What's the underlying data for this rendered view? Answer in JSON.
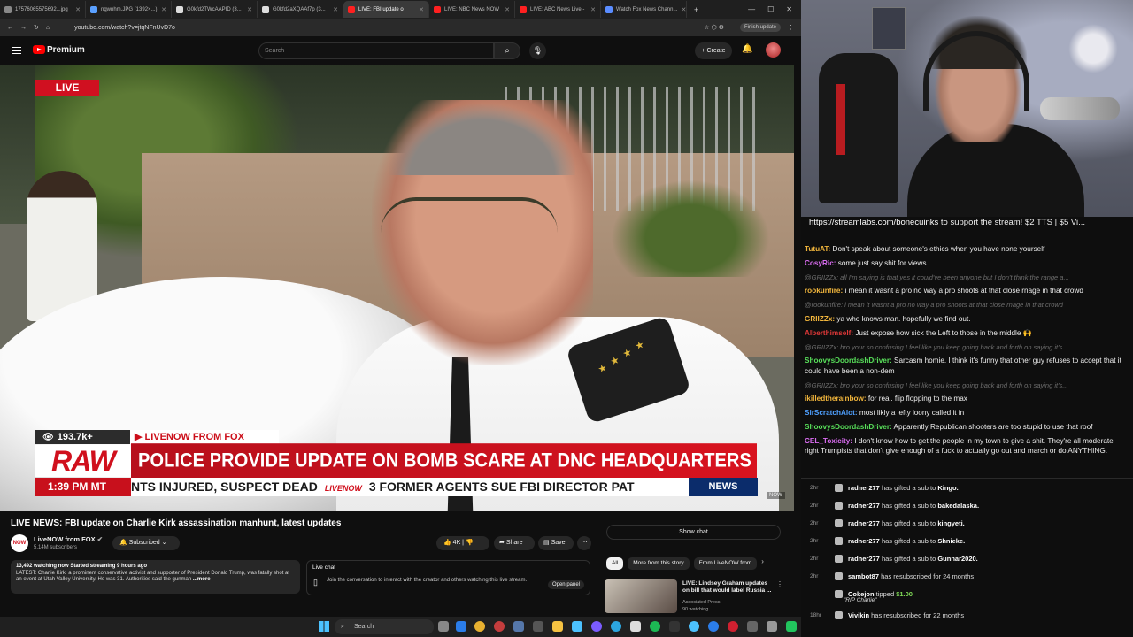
{
  "browser": {
    "tabs": [
      {
        "label": "17576065575692...jpg",
        "color": "#888888",
        "active": false
      },
      {
        "label": "ngwnhm.JPG (1392×...)",
        "color": "#5aa0ff",
        "active": false
      },
      {
        "label": "G0kfd2TWcAAPID (3...",
        "color": "#dddddd",
        "active": false
      },
      {
        "label": "G0kfd2aXQAAf7p (3...",
        "color": "#dddddd",
        "active": false
      },
      {
        "label": "LIVE: FBI update o",
        "color": "#ff2020",
        "active": true
      },
      {
        "label": "LIVE: NBC News NOW",
        "color": "#ff2020",
        "active": false
      },
      {
        "label": "LIVE: ABC News Live -",
        "color": "#ff2020",
        "active": false
      },
      {
        "label": "Watch Fox News Chann...",
        "color": "#5a8cff",
        "active": false
      }
    ],
    "url": "youtube.com/watch?v=jtqNFnUvD7o",
    "update_label": "Finish update"
  },
  "youtube": {
    "brand": "Premium",
    "search_placeholder": "Search",
    "create_label": "Create",
    "live_tag": "LIVE",
    "lower_third": {
      "viewers": "193.7k+",
      "source": "LIVENOW FROM FOX",
      "raw": "RAW",
      "headline": "POLICE PROVIDE UPDATE ON BOMB SCARE AT DNC HEADQUARTERS",
      "time": "1:39 PM MT",
      "ticker_a": "NTS INJURED, SUSPECT DEAD",
      "ticker_logo": "LIVENOW",
      "ticker_b": "3 FORMER AGENTS SUE FBI DIRECTOR PAT",
      "news": "NEWS",
      "watermark": "NOW"
    },
    "video_title": "LIVE NEWS: FBI update on Charlie Kirk assassination manhunt, latest updates",
    "channel": {
      "name": "LiveNOW from FOX",
      "subs": "5.14M subscribers",
      "avatar_text": "NOW"
    },
    "subscribed_label": "Subscribed",
    "like_count": "4K",
    "share_label": "Share",
    "save_label": "Save",
    "description": {
      "stats": "13,492 watching now  Started streaming 9 hours ago",
      "text": "LATEST: Charlie Kirk, a prominent conservative activist and supporter of President Donald Trump, was fatally shot at an event at Utah Valley University. He was 31. Authorities said the gunman",
      "more": "...more"
    },
    "live_chat": {
      "heading": "Live chat",
      "text": "Join the conversation to interact with the creator and others watching this live stream.",
      "open_panel": "Open panel"
    },
    "show_chat": "Show chat",
    "chips": [
      "All",
      "More from this story",
      "From LiveNOW from"
    ],
    "recommendation": {
      "title": "LIVE: Lindsey Graham updates on bill that would label Russia ...",
      "channel": "Associated Press",
      "watching": "90 watching"
    },
    "taskbar_search": "Search"
  },
  "stream_chat": {
    "banner_link": "https://streamlabs.com/bonecuinks",
    "banner_text": " to support the stream! $2 TTS | $5 Vi...",
    "messages": [
      {
        "user": "TutuAT:",
        "color": "#f2b63c",
        "text": " Don't speak about someone's ethics when you have none yourself",
        "dim": false
      },
      {
        "user": "CosyRic:",
        "color": "#d96cf0",
        "text": " some just say shit for views",
        "dim": false
      },
      {
        "user": "@GRIIZZx:",
        "color": "#6e6e6e",
        "text": " all I'm saying is that yes it could've been anyone but I don't think the range a...",
        "dim": true
      },
      {
        "user": "rookunfire:",
        "color": "#f2b63c",
        "text": " i mean it wasnt a pro no way a pro shoots at that close rnage in that crowd",
        "dim": false
      },
      {
        "user": "@rookunfire:",
        "color": "#6e6e6e",
        "text": " i mean it wasnt a pro no way a pro shoots at that close rnage in that crowd",
        "dim": true
      },
      {
        "user": "GRIIZZx:",
        "color": "#f2b63c",
        "text": " ya who knows man. hopefully we find out.",
        "dim": false
      },
      {
        "user": "Alberthimself:",
        "color": "#e03838",
        "text": " Just expose how sick the Left to those in the middle 🙌",
        "dim": false
      },
      {
        "user": "@GRIIZZx:",
        "color": "#6e6e6e",
        "text": " bro your so confusing I feel like you keep going back and forth on saying it's...",
        "dim": true
      },
      {
        "user": "ShoovysDoordashDriver:",
        "color": "#58e05a",
        "text": " Sarcasm homie. I think it's funny that other guy refuses to accept that it could have been a non-dem",
        "dim": false
      },
      {
        "user": "@GRIIZZx:",
        "color": "#6e6e6e",
        "text": " bro your so confusing I feel like you keep going back and forth on saying it's...",
        "dim": true
      },
      {
        "user": "ikilledtherainbow:",
        "color": "#f2b63c",
        "text": " for real. flip flopping to the max",
        "dim": false
      },
      {
        "user": "SirScratchAlot:",
        "color": "#4fa0ff",
        "text": " most likly a lefty loony called it in",
        "dim": false
      },
      {
        "user": "ShoovysDoordashDriver:",
        "color": "#58e05a",
        "text": " Apparently Republican shooters are too stupid to use that roof",
        "dim": false
      },
      {
        "user": "CEL_Toxicity:",
        "color": "#d96cf0",
        "text": " I don't know how to get the people in my town to give a shit. They're all moderate right Trumpists that don't give enough of a fuck to actually go out and march or do ANYTHING.",
        "dim": false
      }
    ],
    "events": [
      {
        "time": "2hr",
        "name": "radner277",
        "text": " has gifted a sub to ",
        "target": "Kingo."
      },
      {
        "time": "2hr",
        "name": "radner277",
        "text": " has gifted a sub to ",
        "target": "bakedalaska."
      },
      {
        "time": "2hr",
        "name": "radner277",
        "text": " has gifted a sub to ",
        "target": "kingyeti."
      },
      {
        "time": "2hr",
        "name": "radner277",
        "text": " has gifted a sub to ",
        "target": "Shnieke."
      },
      {
        "time": "2hr",
        "name": "radner277",
        "text": " has gifted a sub to ",
        "target": "Gunnar2020."
      },
      {
        "time": "2hr",
        "name": "sambot87",
        "text": " has resubscribed for 24 months",
        "target": ""
      },
      {
        "time": "",
        "name": "Cokejon",
        "text": " tipped ",
        "target": "$1.00"
      },
      {
        "time": "18hr",
        "name": "Vivikin",
        "text": " has resubscribed for 22 months",
        "target": ""
      }
    ],
    "tip_message": "\"RIP Charlie\""
  },
  "colors": {
    "live_red": "#d01020",
    "fox_navy": "#0b2c6b",
    "yt_red": "#ff0000"
  }
}
